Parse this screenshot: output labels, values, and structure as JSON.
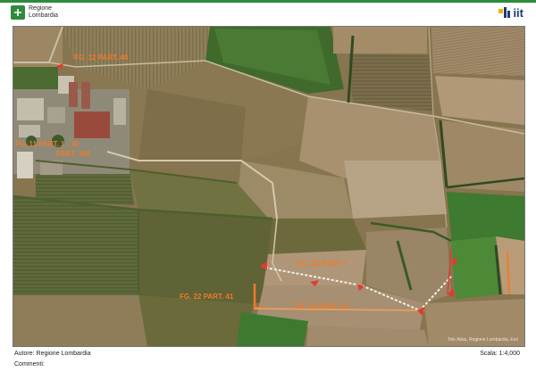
{
  "header": {
    "org_line1": "Regione",
    "org_line2": "Lombardia",
    "logo_right_text": "iit",
    "brand_color": "#2e8b3c"
  },
  "map": {
    "parcel_labels": [
      "FG. 12 PART. 40",
      "FG. 11 PART. 1 - 30",
      "PART. 104",
      "FG. 22 PART. 7",
      "FG. 22 PART. 41",
      "FG. 22 PART. 19"
    ],
    "label_color": "#f07a2a",
    "route_color": "#e23b2e",
    "attribution": "Tele Atlas, Regione Lombardia, Esri"
  },
  "footer": {
    "author": "Autore: Regione Lombardia",
    "scale": "Scala: 1:4,000",
    "comments": "Commenti:"
  }
}
